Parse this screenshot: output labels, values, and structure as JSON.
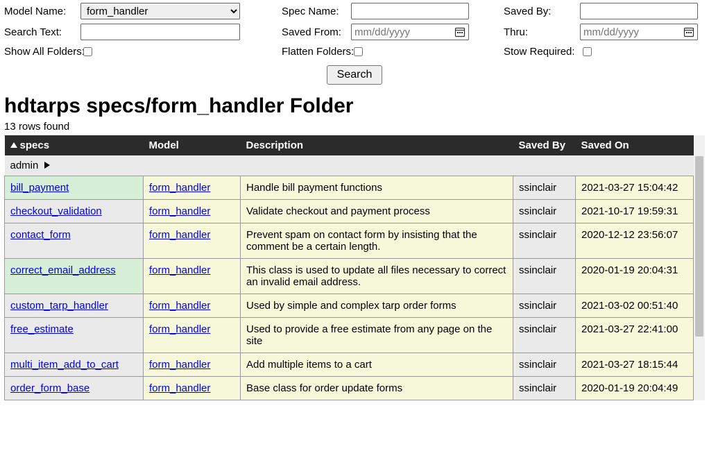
{
  "filters": {
    "model_name_label": "Model Name:",
    "model_name_value": "form_handler",
    "search_text_label": "Search Text:",
    "search_text_value": "",
    "show_all_folders_label": "Show All Folders:",
    "spec_name_label": "Spec Name:",
    "spec_name_value": "",
    "saved_from_label": "Saved From:",
    "saved_from_placeholder": "mm/dd/yyyy",
    "flatten_folders_label": "Flatten Folders:",
    "saved_by_label": "Saved By:",
    "saved_by_value": "",
    "thru_label": "Thru:",
    "thru_placeholder": "mm/dd/yyyy",
    "stow_required_label": "Stow Required:"
  },
  "search_button": "Search",
  "heading": "hdtarps specs/form_handler Folder",
  "row_count_text": "13 rows found",
  "columns": {
    "specs": "specs",
    "model": "Model",
    "description": "Description",
    "saved_by": "Saved By",
    "saved_on": "Saved On"
  },
  "group_label": "admin",
  "rows": [
    {
      "spec": "bill_payment",
      "model": "form_handler",
      "desc": "Handle bill payment functions",
      "by": "ssinclair",
      "on": "2021-03-27 15:04:42",
      "hl": true
    },
    {
      "spec": "checkout_validation",
      "model": "form_handler",
      "desc": "Validate checkout and payment process",
      "by": "ssinclair",
      "on": "2021-10-17 19:59:31",
      "hl": false
    },
    {
      "spec": "contact_form",
      "model": "form_handler",
      "desc": "Prevent spam on contact form by insisting that the comment be a certain length.",
      "by": "ssinclair",
      "on": "2020-12-12 23:56:07",
      "hl": false
    },
    {
      "spec": "correct_email_address",
      "model": "form_handler",
      "desc": "This class is used to update all files necessary to correct an invalid email address.",
      "by": "ssinclair",
      "on": "2020-01-19 20:04:31",
      "hl": true
    },
    {
      "spec": "custom_tarp_handler",
      "model": "form_handler",
      "desc": "Used by simple and complex tarp order forms",
      "by": "ssinclair",
      "on": "2021-03-02 00:51:40",
      "hl": false
    },
    {
      "spec": "free_estimate",
      "model": "form_handler",
      "desc": "Used to provide a free estimate from any page on the site",
      "by": "ssinclair",
      "on": "2021-03-27 22:41:00",
      "hl": false
    },
    {
      "spec": "multi_item_add_to_cart",
      "model": "form_handler",
      "desc": "Add multiple items to a cart",
      "by": "ssinclair",
      "on": "2021-03-27 18:15:44",
      "hl": false
    },
    {
      "spec": "order_form_base",
      "model": "form_handler",
      "desc": "Base class for order update forms",
      "by": "ssinclair",
      "on": "2020-01-19 20:04:49",
      "hl": false
    }
  ]
}
